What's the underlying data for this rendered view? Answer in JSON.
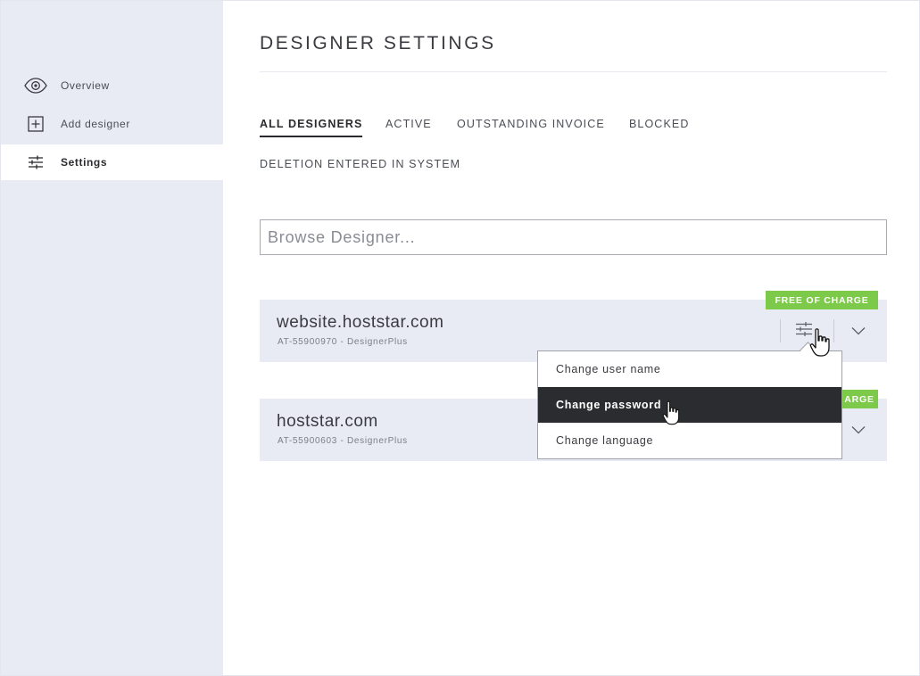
{
  "sidebar": {
    "items": [
      {
        "label": "Overview",
        "icon": "eye-icon"
      },
      {
        "label": "Add designer",
        "icon": "plus-square-icon"
      },
      {
        "label": "Settings",
        "icon": "sliders-icon",
        "active": true
      }
    ]
  },
  "main": {
    "title": "DESIGNER SETTINGS",
    "tabs": [
      {
        "label": "ALL DESIGNERS",
        "active": true
      },
      {
        "label": "ACTIVE"
      },
      {
        "label": "OUTSTANDING INVOICE"
      },
      {
        "label": "BLOCKED"
      },
      {
        "label": "DELETION ENTERED IN SYSTEM"
      }
    ],
    "search": {
      "placeholder": "Browse Designer..."
    },
    "designers": [
      {
        "domain": "website.hoststar.com",
        "meta": "AT-55900970 - DesignerPlus",
        "badge": "FREE OF CHARGE"
      },
      {
        "domain": "hoststar.com",
        "meta": "AT-55900603 - DesignerPlus",
        "badge_visible": "ARGE"
      }
    ],
    "dropdown": {
      "items": [
        {
          "label": "Change user name"
        },
        {
          "label": "Change password",
          "active": true
        },
        {
          "label": "Change language"
        }
      ]
    }
  },
  "colors": {
    "sidebar_bg": "#e8ebf4",
    "badge_green": "#7dc94a",
    "menu_active_bg": "#2b2c30",
    "text_dark": "#2b2b2f"
  }
}
